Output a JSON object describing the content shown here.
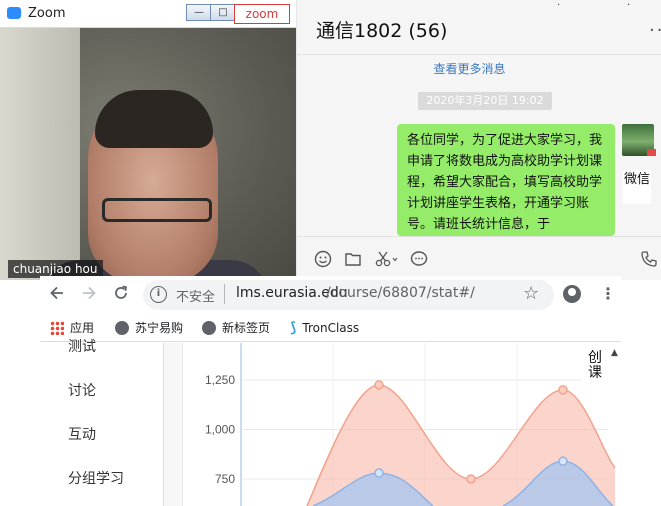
{
  "zoom": {
    "title": "Zoom",
    "overlay_label": "zoom",
    "participant_name": "chuanjiao hou",
    "window_buttons": [
      "—",
      "□"
    ]
  },
  "wechat": {
    "chat_title": "通信1802 (56)",
    "more": "··",
    "view_more": "查看更多消息",
    "timestamp": "2020年3月20日 19:02",
    "message": "各位同学，为了促进大家学习，我申请了将数电成为高校助学计划课程，希望大家配合，填写高校助学计划讲座学生表格，开通学习账号。请班长统计信息，于",
    "side_label": "微信",
    "tools": [
      "emoji-icon",
      "folder-icon",
      "scissors-icon",
      "chat-bubble-icon",
      "phone-icon"
    ]
  },
  "browser": {
    "insecure_label": "不安全",
    "url_host": "lms.eurasia.edu",
    "url_path": "/course/68807/stat#/",
    "bookmarks": [
      {
        "label": "应用",
        "icon": "apps-icon"
      },
      {
        "label": "苏宁易购",
        "icon": "globe-icon"
      },
      {
        "label": "新标签页",
        "icon": "globe-icon"
      },
      {
        "label": "TronClass",
        "icon": "tronclass-icon"
      }
    ],
    "sidebar_items": [
      "测试",
      "讨论",
      "互动",
      "分组学习"
    ],
    "side_badge": "创课"
  },
  "chart_data": {
    "type": "area",
    "y_ticks": [
      "1,250",
      "1,000",
      "750"
    ],
    "ylim": [
      600,
      1350
    ],
    "series": [
      {
        "color": "#f7b3a1",
        "points": [
          null,
          1225,
          750,
          1200,
          null
        ]
      },
      {
        "color": "#a9c6ee",
        "points": [
          null,
          780,
          null,
          840,
          null
        ]
      }
    ],
    "grid": true
  }
}
